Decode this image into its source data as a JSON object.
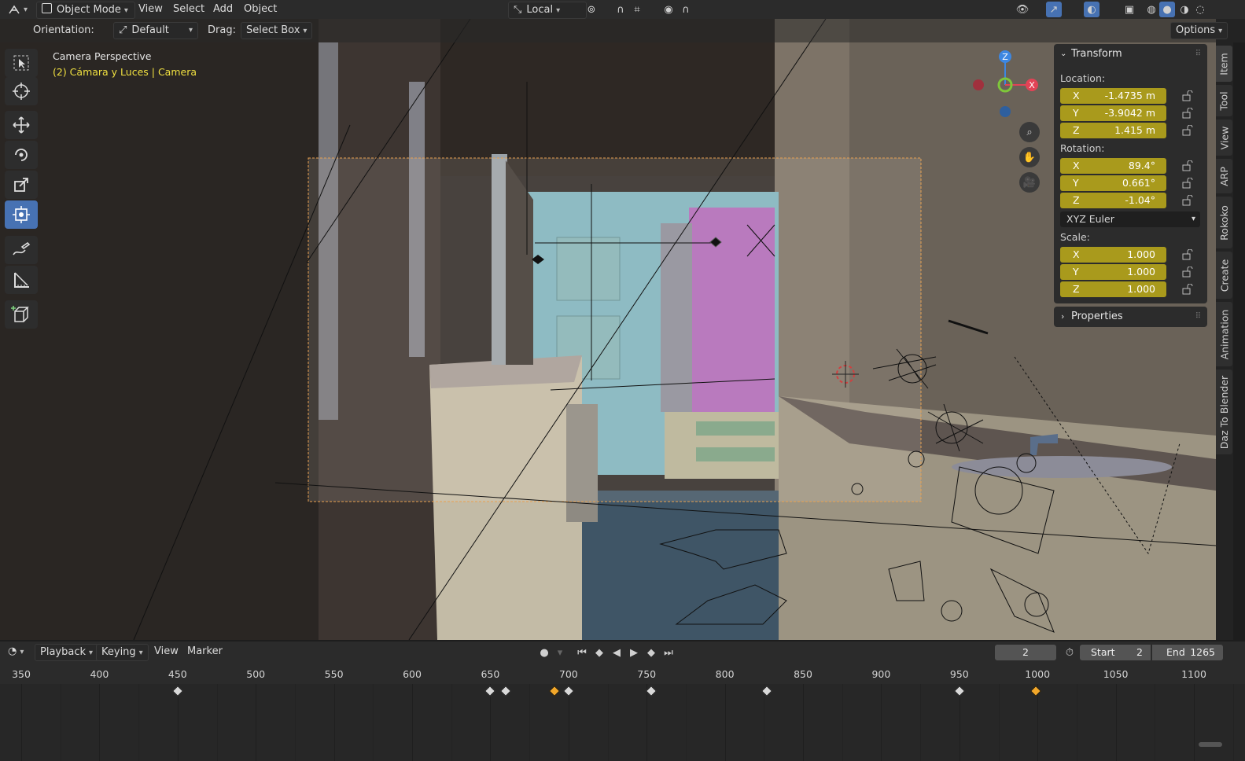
{
  "header": {
    "mode": "Object Mode",
    "menus": [
      "View",
      "Select",
      "Add",
      "Object"
    ],
    "transform_orientation": "Local"
  },
  "tool_header": {
    "orientation_label": "Orientation:",
    "orientation_value": "Default",
    "drag_label": "Drag:",
    "drag_value": "Select Box",
    "options_label": "Options"
  },
  "viewport": {
    "view_name": "Camera Perspective",
    "object_info": "(2) Cámara y Luces | Camera"
  },
  "gizmo": {
    "axes": {
      "z": "Z",
      "x": "X"
    },
    "colors": {
      "x": "#e24356",
      "y": "#7ec73a",
      "z": "#3d87e2"
    }
  },
  "npanel": {
    "transform_title": "Transform",
    "location_label": "Location:",
    "location": [
      {
        "axis": "X",
        "value": "-1.4735 m"
      },
      {
        "axis": "Y",
        "value": "-3.9042 m"
      },
      {
        "axis": "Z",
        "value": "1.415 m"
      }
    ],
    "rotation_label": "Rotation:",
    "rotation": [
      {
        "axis": "X",
        "value": "89.4°"
      },
      {
        "axis": "Y",
        "value": "0.661°"
      },
      {
        "axis": "Z",
        "value": "-1.04°"
      }
    ],
    "rotation_mode": "XYZ Euler",
    "scale_label": "Scale:",
    "scale": [
      {
        "axis": "X",
        "value": "1.000"
      },
      {
        "axis": "Y",
        "value": "1.000"
      },
      {
        "axis": "Z",
        "value": "1.000"
      }
    ],
    "properties_title": "Properties"
  },
  "sidebar_tabs": [
    "Item",
    "Tool",
    "View",
    "ARP",
    "Rokoko",
    "Create",
    "Animation",
    "Daz To Blender"
  ],
  "timeline_header": {
    "menus": [
      "Playback",
      "Keying",
      "View",
      "Marker"
    ],
    "current_frame": "2",
    "start_label": "Start",
    "start_value": "2",
    "end_label": "End",
    "end_value": "1265"
  },
  "timeline": {
    "frame_labels": [
      "350",
      "400",
      "450",
      "500",
      "550",
      "600",
      "650",
      "700",
      "750",
      "800",
      "850",
      "900",
      "950",
      "1000",
      "1050",
      "1100"
    ],
    "keyframes": [
      {
        "frame": 450,
        "selected": false
      },
      {
        "frame": 650,
        "selected": false
      },
      {
        "frame": 660,
        "selected": false
      },
      {
        "frame": 691,
        "selected": true
      },
      {
        "frame": 700,
        "selected": false
      },
      {
        "frame": 753,
        "selected": false
      },
      {
        "frame": 827,
        "selected": false
      },
      {
        "frame": 950,
        "selected": false
      },
      {
        "frame": 999,
        "selected": true
      }
    ]
  },
  "colors": {
    "accent": "#4772b3",
    "field": "#a99a1c",
    "object_text": "#f0e040",
    "camera_frame": "#e8a050"
  }
}
